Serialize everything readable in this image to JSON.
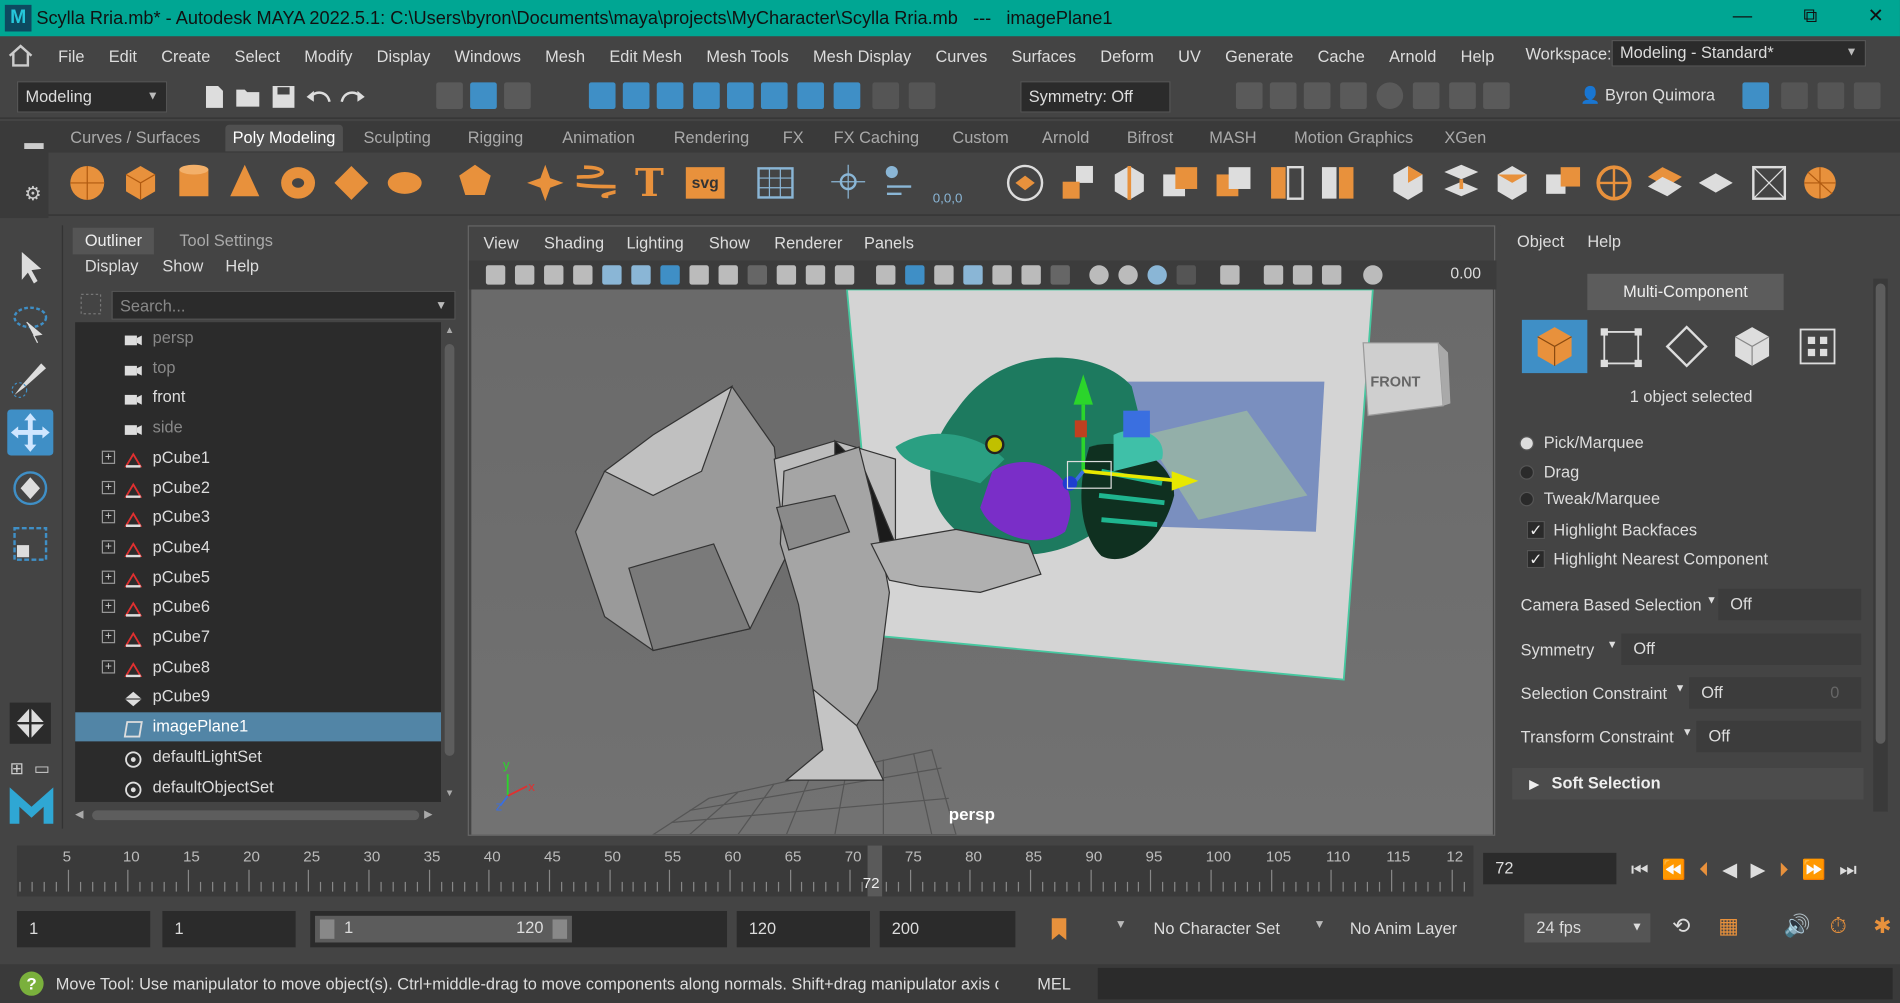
{
  "window": {
    "title": "Scylla Rria.mb* - Autodesk MAYA 2022.5.1: C:\\Users\\byron\\Documents\\maya\\projects\\MyCharacter\\Scylla Rria.mb   ---   imagePlane1",
    "logo": "M",
    "minimize": "—",
    "maximize": "⧉",
    "close": "✕"
  },
  "menubar": {
    "items": [
      "File",
      "Edit",
      "Create",
      "Select",
      "Modify",
      "Display",
      "Windows",
      "Mesh",
      "Edit Mesh",
      "Mesh Tools",
      "Mesh Display",
      "Curves",
      "Surfaces",
      "Deform",
      "UV",
      "Generate",
      "Cache",
      "Arnold",
      "Help"
    ],
    "workspace_label": "Workspace:",
    "workspace_value": "Modeling - Standard*"
  },
  "toolbar": {
    "mode": "Modeling",
    "symmetry": "Symmetry: Off",
    "user": "Byron Quimora"
  },
  "shelf": {
    "tabs": [
      "Curves / Surfaces",
      "Poly Modeling",
      "Sculpting",
      "Rigging",
      "Animation",
      "Rendering",
      "FX",
      "FX Caching",
      "Custom",
      "Arnold",
      "Bifrost",
      "MASH",
      "Motion Graphics",
      "XGen"
    ],
    "active": "Poly Modeling",
    "text_icon": "T",
    "svg_icon": "svg",
    "snap_label": "0,0,0"
  },
  "outliner": {
    "tabs": [
      "Outliner",
      "Tool Settings"
    ],
    "menu": [
      "Display",
      "Show",
      "Help"
    ],
    "search_placeholder": "Search...",
    "items": [
      {
        "label": "persp",
        "type": "camera",
        "dim": true
      },
      {
        "label": "top",
        "type": "camera",
        "dim": true
      },
      {
        "label": "front",
        "type": "camera",
        "dim": false
      },
      {
        "label": "side",
        "type": "camera",
        "dim": true
      },
      {
        "label": "pCube1",
        "type": "mesh"
      },
      {
        "label": "pCube2",
        "type": "mesh"
      },
      {
        "label": "pCube3",
        "type": "mesh"
      },
      {
        "label": "pCube4",
        "type": "mesh"
      },
      {
        "label": "pCube5",
        "type": "mesh"
      },
      {
        "label": "pCube6",
        "type": "mesh"
      },
      {
        "label": "pCube7",
        "type": "mesh"
      },
      {
        "label": "pCube8",
        "type": "mesh"
      },
      {
        "label": "pCube9",
        "type": "mesh-noexp"
      },
      {
        "label": "imagePlane1",
        "type": "imageplane",
        "selected": true
      },
      {
        "label": "defaultLightSet",
        "type": "set"
      },
      {
        "label": "defaultObjectSet",
        "type": "set"
      }
    ]
  },
  "viewport": {
    "menu": [
      "View",
      "Shading",
      "Lighting",
      "Show",
      "Renderer",
      "Panels"
    ],
    "exposure": "0.00",
    "camera_label": "persp",
    "viewcube": "FRONT",
    "axis_y": "y",
    "axis_x": "x",
    "axis_z": "z"
  },
  "attr": {
    "menu": [
      "Object",
      "Help"
    ],
    "multi_component": "Multi-Component",
    "selected_text": "1 object selected",
    "radios": [
      "Pick/Marquee",
      "Drag",
      "Tweak/Marquee"
    ],
    "checks": [
      "Highlight Backfaces",
      "Highlight Nearest Component"
    ],
    "camera_based_selection": {
      "label": "Camera Based Selection",
      "value": "Off"
    },
    "symmetry": {
      "label": "Symmetry",
      "value": "Off"
    },
    "selection_constraint": {
      "label": "Selection Constraint",
      "value": "Off",
      "extra": "0"
    },
    "transform_constraint": {
      "label": "Transform Constraint",
      "value": "Off"
    },
    "soft_selection": "Soft Selection"
  },
  "timeline": {
    "ticks": [
      "5",
      "10",
      "15",
      "20",
      "25",
      "30",
      "35",
      "40",
      "45",
      "50",
      "55",
      "60",
      "65",
      "70",
      "75",
      "80",
      "85",
      "90",
      "95",
      "100",
      "105",
      "110",
      "115",
      "12"
    ],
    "current_frame": "72",
    "frame_field": "72"
  },
  "range": {
    "start": "1",
    "anim_start": "1",
    "slider_start": "1",
    "slider_end": "120",
    "end": "120",
    "anim_end": "200",
    "character_set": "No Character Set",
    "anim_layer": "No Anim Layer",
    "fps": "24 fps"
  },
  "helpline": {
    "text": "Move Tool: Use manipulator to move object(s). Ctrl+middle-drag to move components along normals. Shift+drag manipulator axis or plane h",
    "lang": "MEL"
  },
  "colors": {
    "title_bg": "#00a693",
    "selected_row": "#5285a6",
    "accent_orange": "#e8913c",
    "accent_blue": "#3f8fc6"
  }
}
